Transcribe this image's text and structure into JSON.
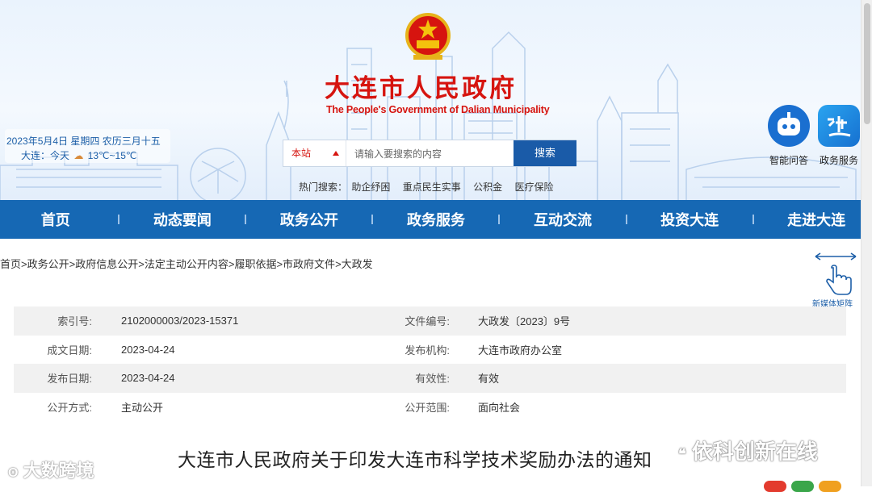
{
  "header": {
    "site_title": "大连市人民政府",
    "site_subtitle": "The People's Government of Dalian Municipality",
    "date_text": "2023年5月4日 星期四 农历三月十五",
    "weather_prefix": "大连：今天",
    "weather_temp": "13℃~15℃",
    "brand_color": "#d6140f"
  },
  "search": {
    "scope": "本站",
    "placeholder": "请输入要搜索的内容",
    "button": "搜索",
    "hot_label": "热门搜索：",
    "hot_terms": [
      "助企纾困",
      "重点民生实事",
      "公积金",
      "医疗保险"
    ]
  },
  "quick_links": [
    {
      "label": "智能问答",
      "icon": "robot-icon",
      "color": "#1a6fd0"
    },
    {
      "label": "政务服务",
      "icon": "lian-service-icon",
      "color": "#1a8fe0"
    }
  ],
  "nav": {
    "items": [
      "首页",
      "动态要闻",
      "政务公开",
      "政务服务",
      "互动交流",
      "投资大连",
      "走进大连"
    ],
    "color": "#1668b4"
  },
  "breadcrumb": [
    "首页",
    "政务公开",
    "政府信息公开",
    "法定主动公开内容",
    "履职依据",
    "市政府文件",
    "大政发"
  ],
  "new_media": {
    "label": "新媒体矩阵",
    "icon": "hand-pointer-icon"
  },
  "meta": [
    {
      "k1": "索引号:",
      "v1": "2102000003/2023-15371",
      "k2": "文件编号:",
      "v2": "大政发〔2023〕9号"
    },
    {
      "k1": "成文日期:",
      "v1": "2023-04-24",
      "k2": "发布机构:",
      "v2": "大连市政府办公室"
    },
    {
      "k1": "发布日期:",
      "v1": "2023-04-24",
      "k2": "有效性:",
      "v2": "有效"
    },
    {
      "k1": "公开方式:",
      "v1": "主动公开",
      "k2": "公开范围:",
      "v2": "面向社会"
    }
  ],
  "document_title": "大连市人民政府关于印发大连市科学技术奖励办法的通知",
  "watermarks": {
    "left": "大数跨境",
    "right": "依科创新在线"
  }
}
